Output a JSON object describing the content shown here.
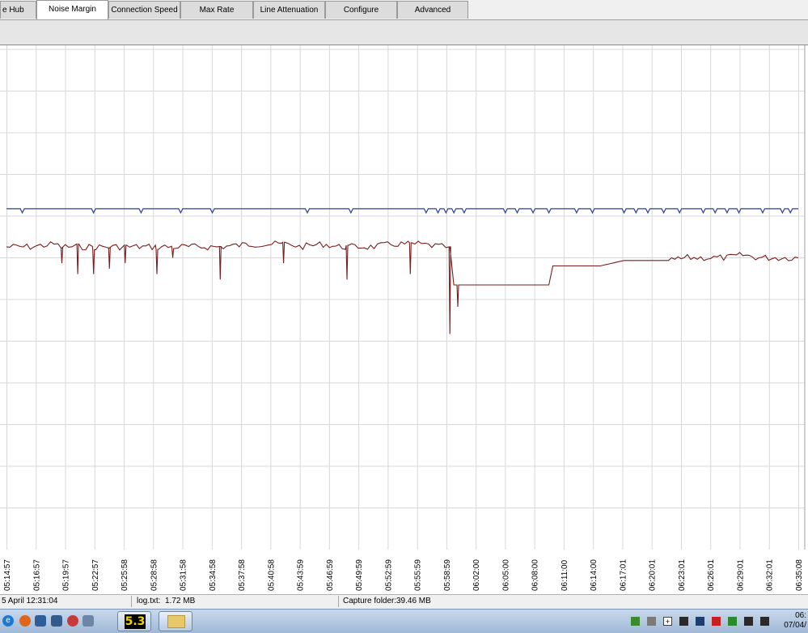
{
  "tabs": [
    {
      "label": "e Hub"
    },
    {
      "label": "Noise Margin"
    },
    {
      "label": "Connection Speed"
    },
    {
      "label": "Max Rate"
    },
    {
      "label": "Line Attenuation"
    },
    {
      "label": "Configure"
    },
    {
      "label": "Advanced"
    }
  ],
  "active_tab": "Noise Margin",
  "chart_data": {
    "type": "line",
    "title": "",
    "xlabel": "",
    "ylabel": "",
    "grid": true,
    "x_tick_labels": [
      "05:14:57",
      "05:16:57",
      "05:19:57",
      "05:22:57",
      "05:25:58",
      "05:28:58",
      "05:31:58",
      "05:34:58",
      "05:37:58",
      "05:40:58",
      "05:43:59",
      "05:46:59",
      "05:49:59",
      "05:52:59",
      "05:55:59",
      "05:58:59",
      "06:02:00",
      "06:05:00",
      "06:08:00",
      "06:11:00",
      "06:14:00",
      "06:17:01",
      "06:20:01",
      "06:23:01",
      "06:26:01",
      "06:29:01",
      "06:32:01",
      "06:35:08"
    ],
    "series": [
      {
        "color": "#2b3f9e",
        "x_start": "05:14:57",
        "x_end": "06:35:08",
        "baseline": 0.3,
        "dips": [
          [
            0.02,
            0.31
          ],
          [
            0.11,
            0.31
          ],
          [
            0.17,
            0.31
          ],
          [
            0.22,
            0.31
          ],
          [
            0.26,
            0.31
          ],
          [
            0.38,
            0.31
          ],
          [
            0.435,
            0.31
          ],
          [
            0.53,
            0.31
          ],
          [
            0.545,
            0.31
          ],
          [
            0.555,
            0.31
          ],
          [
            0.565,
            0.31
          ],
          [
            0.578,
            0.31
          ],
          [
            0.63,
            0.31
          ],
          [
            0.645,
            0.31
          ],
          [
            0.665,
            0.31
          ],
          [
            0.685,
            0.31
          ],
          [
            0.72,
            0.31
          ],
          [
            0.74,
            0.31
          ],
          [
            0.78,
            0.31
          ],
          [
            0.795,
            0.31
          ],
          [
            0.81,
            0.31
          ],
          [
            0.83,
            0.31
          ],
          [
            0.85,
            0.31
          ],
          [
            0.88,
            0.31
          ],
          [
            0.895,
            0.31
          ],
          [
            0.91,
            0.31
          ],
          [
            0.925,
            0.31
          ],
          [
            0.955,
            0.31
          ],
          [
            0.98,
            0.31
          ],
          [
            0.99,
            0.31
          ]
        ]
      },
      {
        "color": "#7b1c1c",
        "x_start": "05:14:57",
        "x_end": "06:35:08",
        "segments": [
          [
            0.0,
            0.37
          ],
          [
            0.03,
            0.37
          ],
          [
            0.06,
            0.365
          ],
          [
            0.07,
            0.37
          ],
          [
            0.1,
            0.37
          ],
          [
            0.13,
            0.37
          ],
          [
            0.16,
            0.37
          ],
          [
            0.2,
            0.37
          ],
          [
            0.23,
            0.37
          ],
          [
            0.27,
            0.37
          ],
          [
            0.31,
            0.365
          ],
          [
            0.36,
            0.365
          ],
          [
            0.37,
            0.37
          ],
          [
            0.4,
            0.365
          ],
          [
            0.42,
            0.37
          ],
          [
            0.46,
            0.37
          ],
          [
            0.49,
            0.365
          ],
          [
            0.52,
            0.365
          ],
          [
            0.55,
            0.37
          ],
          [
            0.56,
            0.37
          ],
          [
            0.565,
            0.44
          ],
          [
            0.58,
            0.44
          ],
          [
            0.63,
            0.44
          ],
          [
            0.685,
            0.44
          ],
          [
            0.69,
            0.405
          ],
          [
            0.75,
            0.405
          ],
          [
            0.78,
            0.395
          ],
          [
            0.84,
            0.395
          ],
          [
            0.86,
            0.39
          ],
          [
            0.91,
            0.39
          ],
          [
            0.93,
            0.385
          ],
          [
            0.95,
            0.39
          ],
          [
            1.0,
            0.39
          ]
        ],
        "spikes": [
          [
            0.07,
            0.4
          ],
          [
            0.09,
            0.42
          ],
          [
            0.11,
            0.42
          ],
          [
            0.13,
            0.41
          ],
          [
            0.15,
            0.4
          ],
          [
            0.19,
            0.42
          ],
          [
            0.21,
            0.39
          ],
          [
            0.27,
            0.43
          ],
          [
            0.35,
            0.4
          ],
          [
            0.43,
            0.43
          ],
          [
            0.51,
            0.42
          ],
          [
            0.56,
            0.53
          ],
          [
            0.57,
            0.48
          ]
        ]
      }
    ]
  },
  "status": {
    "started": "5 April 12:31:04",
    "log_label": "log.txt:",
    "log_size": "1.72 MB",
    "capture_label": "Capture folder:",
    "capture_size": "39.46 MB"
  },
  "taskbar": {
    "app_badge": "5.3",
    "clock_time": "06:",
    "clock_date": "07/04/"
  }
}
